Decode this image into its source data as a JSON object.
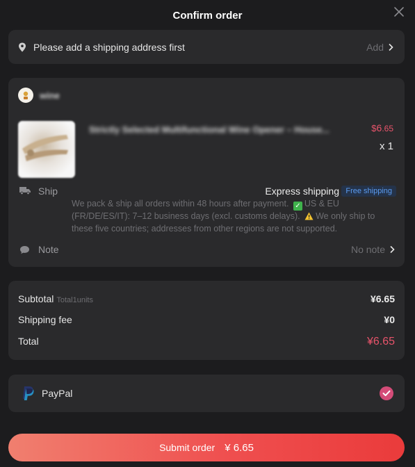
{
  "header": {
    "title": "Confirm order"
  },
  "address": {
    "placeholder_text": "Please add a shipping address first",
    "action": "Add"
  },
  "store": {
    "name": "wine"
  },
  "product": {
    "title": "Strictly Selected Multifunctional Wine Opener – House...",
    "currency": "$",
    "price_int": "6",
    "price_dec": ".65",
    "qty": "x 1"
  },
  "shipping": {
    "label": "Ship",
    "method": "Express shipping",
    "badge": "Free shipping",
    "desc_part1": "We pack & ship all orders within 48 hours after payment.",
    "desc_part2": "US & EU (FR/DE/ES/IT): 7–12 business days (excl. customs delays).",
    "desc_part3": "We only ship to these five countries; addresses from other regions are not supported."
  },
  "note": {
    "label": "Note",
    "value": "No note"
  },
  "summary": {
    "subtotal_label": "Subtotal",
    "subtotal_units": "Total1units",
    "subtotal_value": "¥6.65",
    "shipping_label": "Shipping fee",
    "shipping_value": "¥0",
    "total_label": "Total",
    "total_value": "¥6.65"
  },
  "payment": {
    "method": "PayPal"
  },
  "submit": {
    "label": "Submit order",
    "amount": "¥ 6.65"
  },
  "colors": {
    "accent_pink": "#e8546b",
    "badge_blue": "#5b9bf0",
    "button_red": "#ef4f4f",
    "check_magenta": "#d44c78"
  }
}
